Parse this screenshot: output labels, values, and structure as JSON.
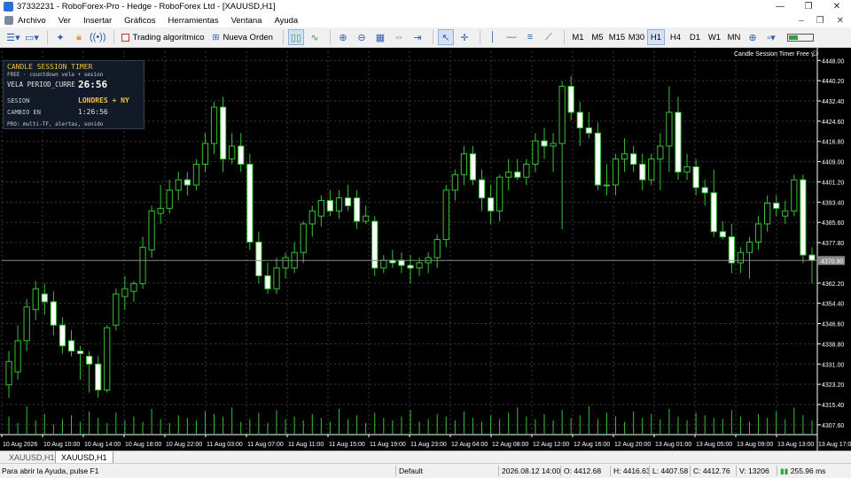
{
  "window": {
    "title": "37332231 - RoboForex-Pro - Hedge - RoboForex Ltd - [XAUUSD,H1]",
    "minimize": "—",
    "restore": "❐",
    "close": "✕"
  },
  "menu": {
    "items": [
      "Archivo",
      "Ver",
      "Insertar",
      "Gráficos",
      "Herramientas",
      "Ventana",
      "Ayuda"
    ],
    "right_min": "–",
    "right_restore": "❐",
    "right_close": "✕"
  },
  "toolbar": {
    "algo_trading": "Trading algorítmico",
    "new_order": "Nueva Orden",
    "timeframes": [
      "M1",
      "M5",
      "M15",
      "M30",
      "H1",
      "H4",
      "D1",
      "W1",
      "MN"
    ],
    "active_timeframe": "H1"
  },
  "overlay": {
    "title": "CANDLE SESSION TIMER",
    "subtitle": "FREE · countdown vela + sesion",
    "period_label": "VELA PERIOD_CURRE",
    "countdown": "26:56",
    "session_label": "SESION",
    "session_value": "LONDRES + NY",
    "change_label": "CAMBIO EN",
    "change_value": "1:26:56",
    "pro_line": "PRO: multi-TF, alertas, sonido"
  },
  "corner_label": "Candle Session Timer Free",
  "tabs": [
    {
      "label": "XAUUSD,H1",
      "active": false
    },
    {
      "label": "XAUUSD,H1",
      "active": true
    }
  ],
  "status": {
    "help": "Para abrir la Ayuda, pulse F1",
    "profile": "Default",
    "datetime": "2026.08.12 14:00",
    "open": "O: 4412.68",
    "high": "H: 4416.63",
    "low": "L: 4407.58",
    "close": "C: 4412.76",
    "volume": "V: 13206",
    "ping": "255.96 ms"
  },
  "colors": {
    "chart_bg": "#000000",
    "bull_fill": "#000000",
    "bear_fill": "#ffffff",
    "candle_outline": "#36c236",
    "grid": "#3a3a3a",
    "axis_text": "#ffffff",
    "volume": "#36c236",
    "price_line": "#8a8a8a"
  },
  "chart_data": {
    "type": "candlestick",
    "symbol": "XAUUSD",
    "timeframe": "H1",
    "y_ticks": [
      4448.0,
      4440.2,
      4432.4,
      4424.6,
      4416.8,
      4409.0,
      4401.2,
      4393.4,
      4385.6,
      4377.8,
      4362.2,
      4354.4,
      4346.6,
      4338.8,
      4331.0,
      4323.2,
      4315.4,
      4307.6
    ],
    "ylim": [
      4303.8,
      4451.5
    ],
    "current_price": "4370.90",
    "current_price_value": 4370.9,
    "x_labels": [
      "10 Aug 2026",
      "10 Aug 10:00",
      "10 Aug 14:00",
      "10 Aug 18:00",
      "10 Aug 22:00",
      "11 Aug 03:00",
      "11 Aug 07:00",
      "11 Aug 11:00",
      "11 Aug 15:00",
      "11 Aug 19:00",
      "11 Aug 23:00",
      "12 Aug 04:00",
      "12 Aug 08:00",
      "12 Aug 12:00",
      "12 Aug 16:00",
      "12 Aug 20:00",
      "13 Aug 01:00",
      "13 Aug 05:00",
      "13 Aug 09:00",
      "13 Aug 13:00",
      "13 Aug 17:00"
    ],
    "candles": [
      {
        "o": 4323,
        "h": 4336,
        "l": 4318,
        "c": 4332
      },
      {
        "o": 4328,
        "h": 4346,
        "l": 4325,
        "c": 4340
      },
      {
        "o": 4340,
        "h": 4356,
        "l": 4336,
        "c": 4353
      },
      {
        "o": 4352,
        "h": 4363,
        "l": 4348,
        "c": 4360
      },
      {
        "o": 4358,
        "h": 4362,
        "l": 4350,
        "c": 4355
      },
      {
        "o": 4355,
        "h": 4359,
        "l": 4342,
        "c": 4346
      },
      {
        "o": 4346,
        "h": 4349,
        "l": 4335,
        "c": 4338
      },
      {
        "o": 4340,
        "h": 4344,
        "l": 4334,
        "c": 4336
      },
      {
        "o": 4336,
        "h": 4338,
        "l": 4325,
        "c": 4335
      },
      {
        "o": 4334,
        "h": 4336,
        "l": 4320,
        "c": 4331
      },
      {
        "o": 4331,
        "h": 4334,
        "l": 4318,
        "c": 4321
      },
      {
        "o": 4321,
        "h": 4346,
        "l": 4320,
        "c": 4345
      },
      {
        "o": 4346,
        "h": 4360,
        "l": 4344,
        "c": 4358
      },
      {
        "o": 4357,
        "h": 4365,
        "l": 4352,
        "c": 4360
      },
      {
        "o": 4359,
        "h": 4363,
        "l": 4355,
        "c": 4362
      },
      {
        "o": 4362,
        "h": 4380,
        "l": 4360,
        "c": 4376
      },
      {
        "o": 4375,
        "h": 4392,
        "l": 4372,
        "c": 4390
      },
      {
        "o": 4389,
        "h": 4400,
        "l": 4385,
        "c": 4391
      },
      {
        "o": 4391,
        "h": 4402,
        "l": 4389,
        "c": 4398
      },
      {
        "o": 4398,
        "h": 4405,
        "l": 4394,
        "c": 4402
      },
      {
        "o": 4402,
        "h": 4405,
        "l": 4396,
        "c": 4400
      },
      {
        "o": 4400,
        "h": 4410,
        "l": 4398,
        "c": 4408
      },
      {
        "o": 4408,
        "h": 4420,
        "l": 4405,
        "c": 4416
      },
      {
        "o": 4416,
        "h": 4432,
        "l": 4412,
        "c": 4430
      },
      {
        "o": 4430,
        "h": 4434,
        "l": 4405,
        "c": 4410
      },
      {
        "o": 4410,
        "h": 4420,
        "l": 4408,
        "c": 4415
      },
      {
        "o": 4415,
        "h": 4420,
        "l": 4405,
        "c": 4408
      },
      {
        "o": 4408,
        "h": 4412,
        "l": 4375,
        "c": 4378
      },
      {
        "o": 4378,
        "h": 4382,
        "l": 4362,
        "c": 4365
      },
      {
        "o": 4365,
        "h": 4370,
        "l": 4358,
        "c": 4360
      },
      {
        "o": 4360,
        "h": 4372,
        "l": 4358,
        "c": 4368
      },
      {
        "o": 4368,
        "h": 4374,
        "l": 4364,
        "c": 4372
      },
      {
        "o": 4368,
        "h": 4378,
        "l": 4366,
        "c": 4374
      },
      {
        "o": 4374,
        "h": 4386,
        "l": 4370,
        "c": 4385
      },
      {
        "o": 4385,
        "h": 4392,
        "l": 4380,
        "c": 4390
      },
      {
        "o": 4388,
        "h": 4396,
        "l": 4384,
        "c": 4394
      },
      {
        "o": 4394,
        "h": 4398,
        "l": 4388,
        "c": 4390
      },
      {
        "o": 4390,
        "h": 4398,
        "l": 4387,
        "c": 4395
      },
      {
        "o": 4395,
        "h": 4400,
        "l": 4390,
        "c": 4392
      },
      {
        "o": 4395,
        "h": 4398,
        "l": 4383,
        "c": 4386
      },
      {
        "o": 4386,
        "h": 4392,
        "l": 4385,
        "c": 4388
      },
      {
        "o": 4386,
        "h": 4388,
        "l": 4365,
        "c": 4368
      },
      {
        "o": 4368,
        "h": 4373,
        "l": 4366,
        "c": 4371
      },
      {
        "o": 4371,
        "h": 4375,
        "l": 4368,
        "c": 4370
      },
      {
        "o": 4371,
        "h": 4374,
        "l": 4366,
        "c": 4369
      },
      {
        "o": 4369,
        "h": 4373,
        "l": 4362,
        "c": 4368
      },
      {
        "o": 4368,
        "h": 4372,
        "l": 4365,
        "c": 4370
      },
      {
        "o": 4370,
        "h": 4374,
        "l": 4366,
        "c": 4372
      },
      {
        "o": 4372,
        "h": 4381,
        "l": 4368,
        "c": 4379
      },
      {
        "o": 4379,
        "h": 4400,
        "l": 4376,
        "c": 4398
      },
      {
        "o": 4398,
        "h": 4406,
        "l": 4394,
        "c": 4404
      },
      {
        "o": 4404,
        "h": 4415,
        "l": 4400,
        "c": 4412
      },
      {
        "o": 4412,
        "h": 4415,
        "l": 4400,
        "c": 4402
      },
      {
        "o": 4402,
        "h": 4406,
        "l": 4390,
        "c": 4395
      },
      {
        "o": 4395,
        "h": 4400,
        "l": 4385,
        "c": 4390
      },
      {
        "o": 4390,
        "h": 4404,
        "l": 4386,
        "c": 4403
      },
      {
        "o": 4403,
        "h": 4410,
        "l": 4398,
        "c": 4405
      },
      {
        "o": 4405,
        "h": 4410,
        "l": 4402,
        "c": 4403
      },
      {
        "o": 4403,
        "h": 4410,
        "l": 4400,
        "c": 4408
      },
      {
        "o": 4408,
        "h": 4420,
        "l": 4405,
        "c": 4417
      },
      {
        "o": 4417,
        "h": 4422,
        "l": 4410,
        "c": 4415
      },
      {
        "o": 4415,
        "h": 4420,
        "l": 4405,
        "c": 4416
      },
      {
        "o": 4416,
        "h": 4440,
        "l": 4383,
        "c": 4438
      },
      {
        "o": 4438,
        "h": 4442,
        "l": 4425,
        "c": 4428
      },
      {
        "o": 4428,
        "h": 4432,
        "l": 4415,
        "c": 4422
      },
      {
        "o": 4422,
        "h": 4428,
        "l": 4418,
        "c": 4420
      },
      {
        "o": 4420,
        "h": 4424,
        "l": 4398,
        "c": 4400
      },
      {
        "o": 4400,
        "h": 4408,
        "l": 4396,
        "c": 4400
      },
      {
        "o": 4400,
        "h": 4412,
        "l": 4396,
        "c": 4410
      },
      {
        "o": 4410,
        "h": 4418,
        "l": 4405,
        "c": 4412
      },
      {
        "o": 4412,
        "h": 4415,
        "l": 4405,
        "c": 4408
      },
      {
        "o": 4408,
        "h": 4412,
        "l": 4398,
        "c": 4402
      },
      {
        "o": 4402,
        "h": 4412,
        "l": 4400,
        "c": 4410
      },
      {
        "o": 4410,
        "h": 4420,
        "l": 4398,
        "c": 4415
      },
      {
        "o": 4415,
        "h": 4438,
        "l": 4405,
        "c": 4428
      },
      {
        "o": 4428,
        "h": 4434,
        "l": 4402,
        "c": 4405
      },
      {
        "o": 4405,
        "h": 4412,
        "l": 4402,
        "c": 4407
      },
      {
        "o": 4407,
        "h": 4410,
        "l": 4396,
        "c": 4399
      },
      {
        "o": 4399,
        "h": 4402,
        "l": 4392,
        "c": 4397
      },
      {
        "o": 4397,
        "h": 4406,
        "l": 4380,
        "c": 4382
      },
      {
        "o": 4382,
        "h": 4386,
        "l": 4379,
        "c": 4380
      },
      {
        "o": 4380,
        "h": 4385,
        "l": 4366,
        "c": 4370
      },
      {
        "o": 4370,
        "h": 4376,
        "l": 4366,
        "c": 4374
      },
      {
        "o": 4374,
        "h": 4380,
        "l": 4364,
        "c": 4378
      },
      {
        "o": 4378,
        "h": 4388,
        "l": 4375,
        "c": 4385
      },
      {
        "o": 4385,
        "h": 4396,
        "l": 4382,
        "c": 4393
      },
      {
        "o": 4393,
        "h": 4396,
        "l": 4388,
        "c": 4391
      },
      {
        "o": 4388,
        "h": 4394,
        "l": 4385,
        "c": 4390
      },
      {
        "o": 4390,
        "h": 4404,
        "l": 4388,
        "c": 4402
      },
      {
        "o": 4402,
        "h": 4404,
        "l": 4370,
        "c": 4373
      },
      {
        "o": 4373,
        "h": 4376,
        "l": 4362,
        "c": 4371
      }
    ],
    "volumes": [
      14,
      9,
      22,
      11,
      16,
      8,
      12,
      15,
      10,
      18,
      13,
      9,
      17,
      11,
      14,
      10,
      20,
      12,
      9,
      15,
      13,
      11,
      18,
      16,
      14,
      21,
      10,
      12,
      17,
      9,
      19,
      12,
      14,
      11,
      16,
      13,
      10,
      20,
      12,
      15,
      9,
      17,
      13,
      11,
      14,
      19,
      10,
      12,
      16,
      14,
      11,
      18,
      13,
      10,
      15,
      12,
      17,
      21,
      14,
      12,
      16,
      11,
      19,
      13,
      15,
      22,
      12,
      17,
      14,
      10,
      18,
      13,
      16,
      12,
      20,
      14,
      11,
      17,
      15,
      13,
      12,
      19,
      14,
      10,
      16,
      13,
      18,
      12,
      21,
      15,
      11
    ]
  }
}
